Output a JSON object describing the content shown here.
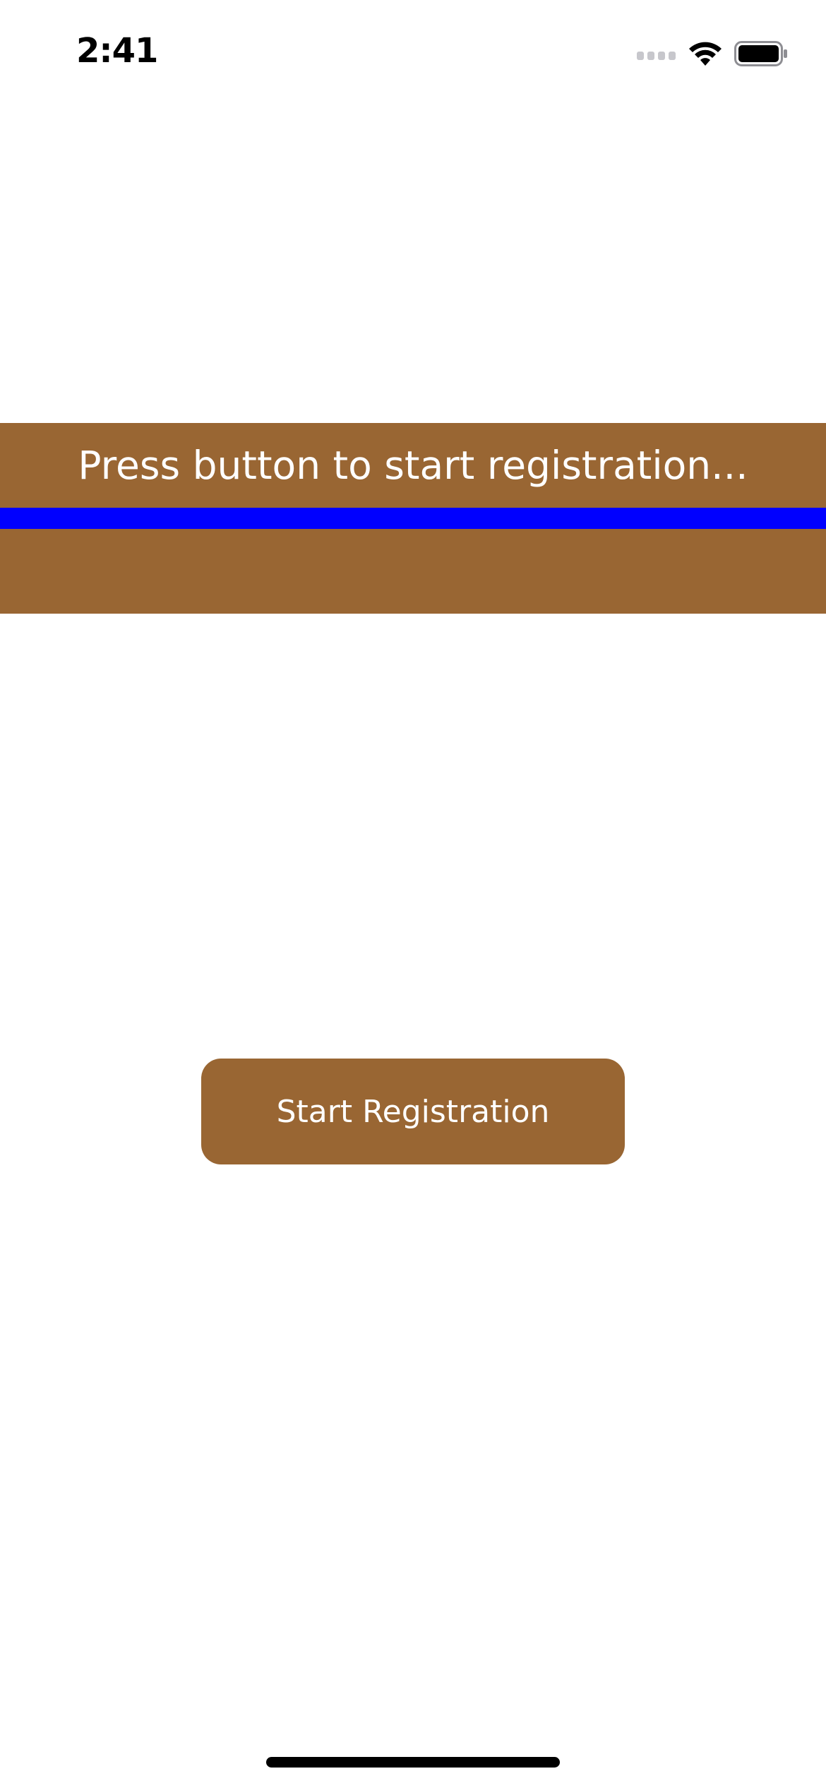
{
  "status_bar": {
    "time": "2:41",
    "icons": [
      "signal-icon",
      "wifi-icon",
      "battery-icon"
    ]
  },
  "banner": {
    "message": "Press button to start registration...",
    "background_color": "#996633",
    "text_color": "#FFFFFF"
  },
  "progress": {
    "value": 1.0,
    "fill_color": "#0000FF"
  },
  "button": {
    "label": "Start Registration",
    "background_color": "#996633",
    "text_color": "#FFFFFF"
  }
}
